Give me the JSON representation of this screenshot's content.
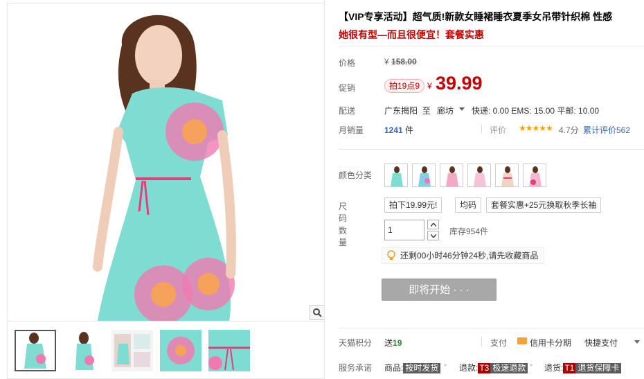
{
  "product": {
    "title": "【VIP专享活动】超气质!新款女睡裙睡衣夏季女吊带针织棉 性感",
    "subtitle": "她很有型—而且很便宜！套餐实惠"
  },
  "price": {
    "label": "价格",
    "currency": "¥",
    "original": "158.00",
    "promo_label": "促销",
    "promo_tag": "拍19点9",
    "sale": "39.99"
  },
  "shipping": {
    "label": "配送",
    "from": "广东揭阳",
    "to_word": "至",
    "to": "廊坊",
    "fees": "快递: 0.00 EMS: 15.00 平邮: 10.00"
  },
  "sales": {
    "label": "月销量",
    "count": "1241",
    "unit": "件",
    "rating_label": "评价",
    "stars": "★★★★★",
    "score": "4.7分",
    "reviews": "累计评价562"
  },
  "options": {
    "color_label": "颜色分类",
    "size_label": "尺码",
    "sizes": [
      "拍下19.99元!",
      "均码",
      "套餐实惠+25元换取秋季长袖"
    ],
    "qty_label": "数量",
    "qty_value": "1",
    "stock": "库存954件"
  },
  "notice": "还剩00小时46分钟24秒,请先收藏商品",
  "buy_button": "即将开始 · · ·",
  "points": {
    "label": "天猫积分",
    "prefix": "送",
    "value": "19"
  },
  "payment": {
    "label": "支付",
    "card": "信用卡分期",
    "quick": "快捷支付"
  },
  "service": {
    "label": "服务承诺",
    "items": [
      {
        "prefix": "商品:",
        "tag": "按时发货"
      },
      {
        "prefix": "退款:",
        "code": "T3",
        "tag": "极速退款"
      },
      {
        "prefix": "退货:",
        "code": "T1",
        "tag": "退货保障卡"
      }
    ]
  },
  "colors": {
    "dress_teal": "#7fdcd2",
    "accent_pink": "#e0407a",
    "price_red": "#c40000",
    "link_blue": "#3366aa"
  }
}
